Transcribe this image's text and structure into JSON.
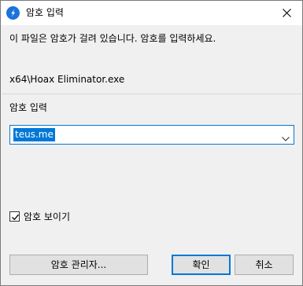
{
  "window": {
    "title": "암호 입력",
    "title_icon": "app-logo-icon",
    "close_icon": "close-icon"
  },
  "message": "이 파일은 암호가 걸려 있습니다. 암호를 입력하세요.",
  "filename": "x64\\Hoax Eliminator.exe",
  "password": {
    "label": "암호 입력",
    "value": "teus.me",
    "dropdown_icon": "chevron-down-icon"
  },
  "show_password": {
    "label": "암호 보이기",
    "checked": true
  },
  "buttons": {
    "manager": "암호 관리자...",
    "ok": "확인",
    "cancel": "취소"
  },
  "colors": {
    "accent": "#0078d7",
    "title_icon": "#1a73d9"
  }
}
